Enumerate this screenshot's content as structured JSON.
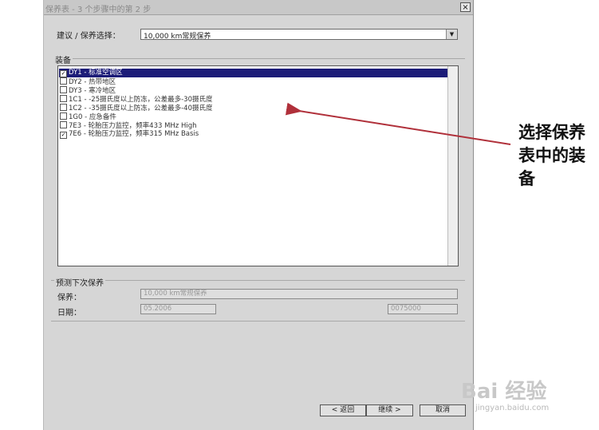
{
  "window": {
    "title": "保养表 - 3 个步骤中的第 2 步",
    "close_glyph": "×"
  },
  "form": {
    "suggestion_label": "建议 / 保养选择：",
    "suggestion_value": "10,000 km常规保养",
    "equipment_group_label": "装备"
  },
  "equipment_list": [
    {
      "checked": true,
      "selected": true,
      "text": "DY1 - 标准空调区"
    },
    {
      "checked": false,
      "selected": false,
      "text": "DY2 - 热带地区"
    },
    {
      "checked": false,
      "selected": false,
      "text": "DY3 - 寒冷地区"
    },
    {
      "checked": false,
      "selected": false,
      "text": "1C1 - -25摄氏度以上防冻，公差最多-30摄氏度"
    },
    {
      "checked": false,
      "selected": false,
      "text": "1C2 - -35摄氏度以上防冻，公差最多-40摄氏度"
    },
    {
      "checked": false,
      "selected": false,
      "text": "1G0 - 应急备件"
    },
    {
      "checked": false,
      "selected": false,
      "text": "7E3 - 轮胎压力监控，频率433 MHz High"
    },
    {
      "checked": true,
      "selected": false,
      "text": "7E6 - 轮胎压力监控，频率315 MHz Basis"
    }
  ],
  "next_service": {
    "group_label": "预测下次保养",
    "service_label": "保养：",
    "service_value": "10,000 km常规保养",
    "date_label": "日期：",
    "date_value": "05.2006",
    "distance_value": "0075000"
  },
  "buttons": {
    "back": "< 返回",
    "next": "继续 >",
    "cancel": "取消"
  },
  "annotation": {
    "text": "选择保养表中的装备",
    "arrow_color": "#b0303a"
  },
  "watermark": {
    "brand": "Bai 经验",
    "url": "jingyan.baidu.com"
  }
}
